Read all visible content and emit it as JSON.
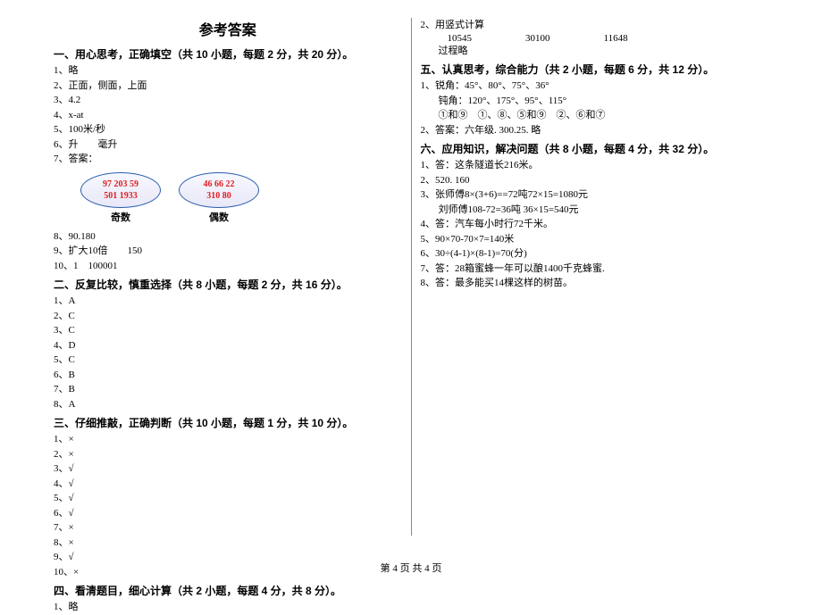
{
  "title": "参考答案",
  "footer": "第 4 页  共 4 页",
  "left": {
    "s1": {
      "header": "一、用心思考，正确填空（共 10 小题，每题 2 分，共 20 分）。",
      "i1": "1、略",
      "i2": "2、正面，侧面，上面",
      "i3": "3、4.2",
      "i4": "4、x-at",
      "i5": "5、100米/秒",
      "i6": "6、升　　毫升",
      "i7": "7、答案：",
      "oval1_l1": "97  203  59",
      "oval1_l2": "501  1933",
      "oval1_label": "奇数",
      "oval2_l1": "46  66  22",
      "oval2_l2": "310  80",
      "oval2_label": "偶数",
      "i8": "8、90.180",
      "i9": "9、扩大10倍　　150",
      "i10": "10、1　100001"
    },
    "s2": {
      "header": "二、反复比较，慎重选择（共 8 小题，每题 2 分，共 16 分）。",
      "i1": "1、A",
      "i2": "2、C",
      "i3": "3、C",
      "i4": "4、D",
      "i5": "5、C",
      "i6": "6、B",
      "i7": "7、B",
      "i8": "8、A"
    },
    "s3": {
      "header": "三、仔细推敲，正确判断（共 10 小题，每题 1 分，共 10 分）。",
      "i1": "1、×",
      "i2": "2、×",
      "i3": "3、√",
      "i4": "4、√",
      "i5": "5、√",
      "i6": "6、√",
      "i7": "7、×",
      "i8": "8、×",
      "i9": "9、√",
      "i10": "10、×"
    },
    "s4": {
      "header": "四、看清题目，细心计算（共 2 小题，每题 4 分，共 8 分）。",
      "i1": "1、略"
    }
  },
  "right": {
    "s4c": {
      "i2": "2、用竖式计算",
      "v1": "10545",
      "v2": "30100",
      "v3": "11648",
      "i3": "过程略"
    },
    "s5": {
      "header": "五、认真思考，综合能力（共 2 小题，每题 6 分，共 12 分）。",
      "i1a": "1、锐角：45°、80°、75°、36°",
      "i1b": "钝角：120°、175°、95°、115°",
      "i1c": "①和⑨　①、⑧、⑤和⑨　②、⑥和⑦",
      "i2": "2、答案：六年级. 300.25. 略"
    },
    "s6": {
      "header": "六、应用知识，解决问题（共 8 小题，每题 4 分，共 32 分）。",
      "i1": "1、答：这条隧道长216米。",
      "i2": "2、520. 160",
      "i3a": "3、张师傅8×(3+6)==72吨72×15=1080元",
      "i3b": "刘师傅108-72=36吨  36×15=540元",
      "i4": "4、答：汽车每小时行72千米。",
      "i5": "5、90×70-70×7=140米",
      "i6": "6、30÷(4-1)×(8-1)=70(分)",
      "i7": "7、答：28箱蜜蜂一年可以酿1400千克蜂蜜.",
      "i8": "8、答：最多能买14棵这样的树苗。"
    }
  }
}
